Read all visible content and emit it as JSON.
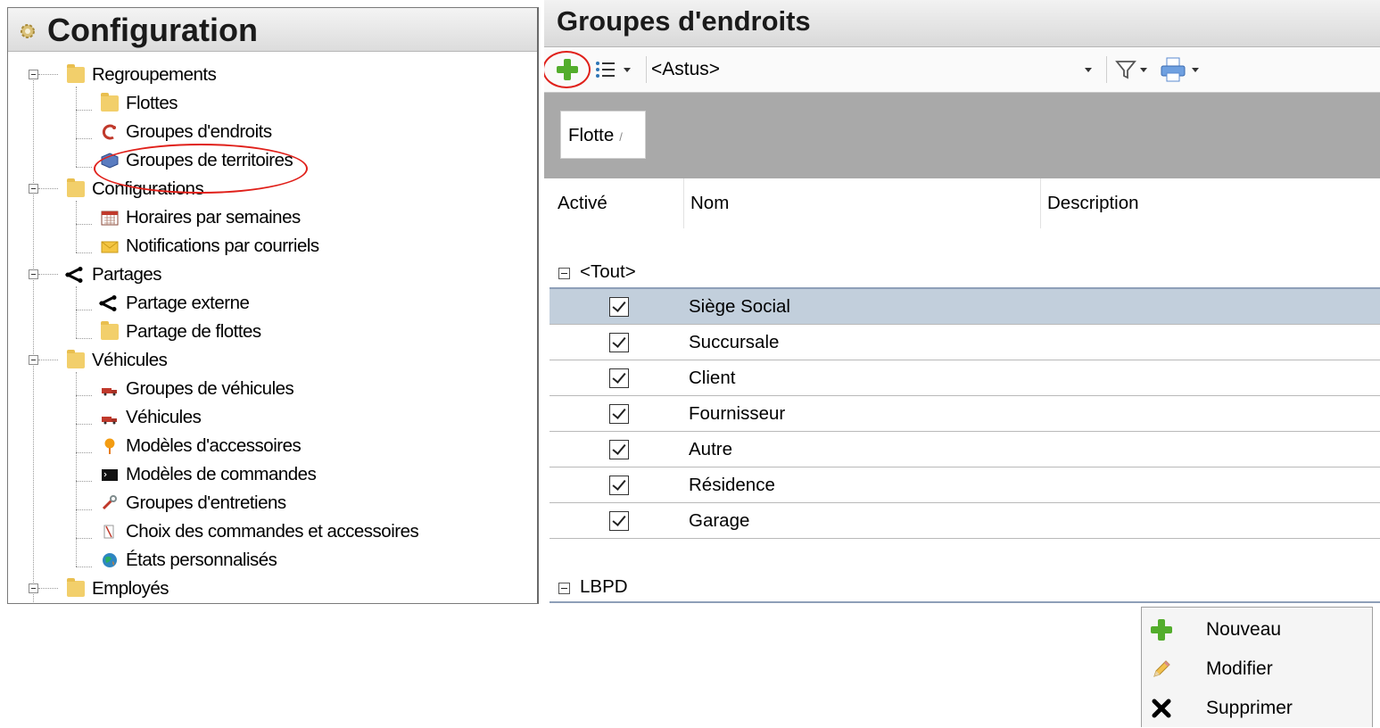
{
  "left_panel": {
    "title": "Configuration",
    "tree": [
      {
        "label": "Regroupements",
        "icon": "folder-icon"
      },
      {
        "label": "Flottes",
        "icon": "folder-icon"
      },
      {
        "label": "Groupes d'endroits",
        "icon": "location-group-icon"
      },
      {
        "label": "Groupes de territoires",
        "icon": "territory-icon"
      },
      {
        "label": "Configurations",
        "icon": "folder-icon"
      },
      {
        "label": "Horaires par semaines",
        "icon": "calendar-icon"
      },
      {
        "label": "Notifications par courriels",
        "icon": "envelope-icon"
      },
      {
        "label": "Partages",
        "icon": "share-icon"
      },
      {
        "label": "Partage externe",
        "icon": "share-icon"
      },
      {
        "label": "Partage de flottes",
        "icon": "fleet-share-icon"
      },
      {
        "label": "Véhicules",
        "icon": "folder-icon"
      },
      {
        "label": "Groupes de véhicules",
        "icon": "truck-icon"
      },
      {
        "label": "Véhicules",
        "icon": "truck-icon"
      },
      {
        "label": "Modèles d'accessoires",
        "icon": "pin-icon"
      },
      {
        "label": "Modèles de commandes",
        "icon": "terminal-icon"
      },
      {
        "label": "Groupes d'entretiens",
        "icon": "wrench-icon"
      },
      {
        "label": "Choix des commandes et accessoires",
        "icon": "checklist-icon"
      },
      {
        "label": "États personnalisés",
        "icon": "globe-icon"
      },
      {
        "label": "Employés",
        "icon": "folder-icon"
      }
    ]
  },
  "right_panel": {
    "title": "Groupes d'endroits",
    "toolbar": {
      "filter_value": "<Astus>"
    },
    "group_chip": "Flotte",
    "columns": [
      "Activé",
      "Nom",
      "Description"
    ],
    "groups": [
      {
        "name": "<Tout>",
        "rows": [
          {
            "active": true,
            "name": "Siège Social",
            "selected": true
          },
          {
            "active": true,
            "name": "Succursale"
          },
          {
            "active": true,
            "name": "Client"
          },
          {
            "active": true,
            "name": "Fournisseur"
          },
          {
            "active": true,
            "name": "Autre"
          },
          {
            "active": true,
            "name": "Résidence"
          },
          {
            "active": true,
            "name": "Garage"
          }
        ]
      },
      {
        "name": "LBPD",
        "rows": []
      }
    ]
  },
  "context_menu": {
    "items": [
      {
        "label": "Nouveau",
        "icon": "plus-icon"
      },
      {
        "label": "Modifier",
        "icon": "pencil-icon"
      },
      {
        "label": "Supprimer",
        "icon": "x-icon"
      }
    ]
  },
  "colors": {
    "selection": "#c2cfdc",
    "highlight_circle": "#e0201a",
    "add_green": "#53ad2c"
  }
}
